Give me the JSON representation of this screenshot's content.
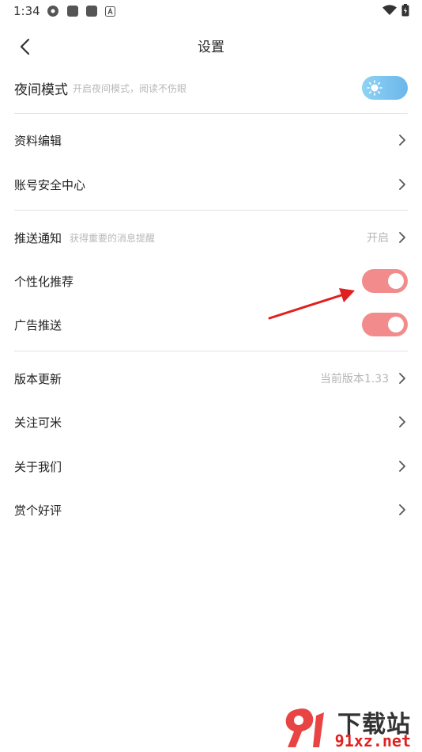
{
  "status": {
    "time": "1:34"
  },
  "header": {
    "title": "设置"
  },
  "night_mode": {
    "title": "夜间模式",
    "subtitle": "开启夜间模式，阅读不伤眼",
    "enabled": false
  },
  "account_group": [
    {
      "label": "资料编辑"
    },
    {
      "label": "账号安全中心"
    }
  ],
  "push": {
    "label": "推送通知",
    "subtitle": "获得重要的消息提醒",
    "value": "开启"
  },
  "personalized": {
    "label": "个性化推荐",
    "enabled": true
  },
  "ads": {
    "label": "广告推送",
    "enabled": true
  },
  "about_group": {
    "version": {
      "label": "版本更新",
      "value": "当前版本1.33"
    },
    "follow": {
      "label": "关注可米"
    },
    "about_us": {
      "label": "关于我们"
    },
    "rate": {
      "label": "赏个好评"
    }
  },
  "watermark": {
    "top": "下载站",
    "bottom": "91xz.net"
  },
  "colors": {
    "toggle_on": "#f28b8b",
    "night_toggle": "#7ec4f0",
    "annotation_arrow": "#e02020"
  }
}
